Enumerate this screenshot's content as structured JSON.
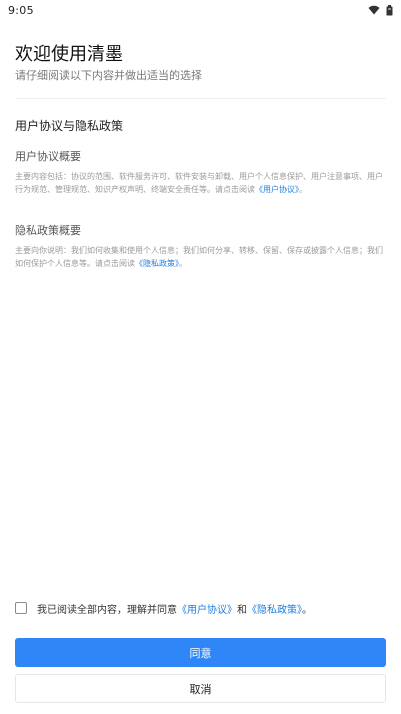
{
  "status_bar": {
    "time": "9:05",
    "icons": [
      "wifi-icon",
      "battery-icon"
    ]
  },
  "header": {
    "title": "欢迎使用清墨",
    "subtitle": "请仔细阅读以下内容并做出适当的选择"
  },
  "section": {
    "title": "用户协议与隐私政策"
  },
  "user_agreement": {
    "heading": "用户协议概要",
    "body_text": "主要内容包括：协议的范围、软件服务许可、软件安装与卸载、用户个人信息保护、用户注意事项、用户行为规范、管理规范、知识产权声明、终端安全责任等。请点击阅读",
    "link_text": "《用户协议》",
    "suffix": "。"
  },
  "privacy_policy": {
    "heading": "隐私政策概要",
    "body_text": "主要向你说明：我们如何收集和使用个人信息；我们如何分享、转移、保留、保存或披露个人信息；我们如何保护个人信息等。请点击阅读",
    "link_text": "《隐私政策》",
    "suffix": "。"
  },
  "consent": {
    "checked": false,
    "prefix": "我已阅读全部内容，理解并同意",
    "link_user_agreement": "《用户协议》",
    "and": "和",
    "link_privacy_policy": "《隐私政策》",
    "suffix": "。"
  },
  "buttons": {
    "agree_label": "同意",
    "cancel_label": "取消"
  },
  "colors": {
    "accent": "#2f86f6",
    "link": "#1e7fe0"
  }
}
